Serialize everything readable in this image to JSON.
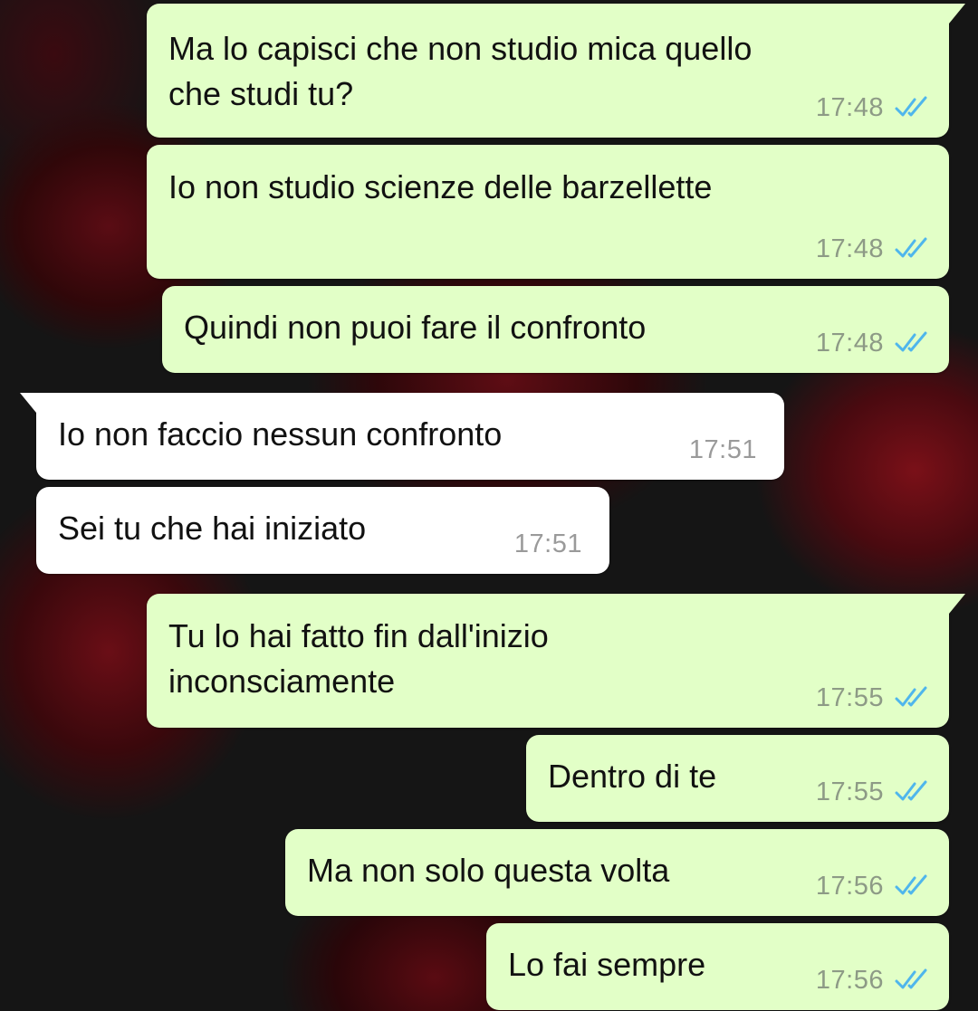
{
  "chat": {
    "accent_tick_color": "#4fb6ec",
    "outgoing_bubble_color": "#e2ffc7",
    "incoming_bubble_color": "#ffffff",
    "messages": [
      {
        "direction": "outgoing",
        "text": "Ma lo capisci che non studio mica quello\nche studi tu?",
        "time": "17:48",
        "status": "read-double-tick-icon"
      },
      {
        "direction": "outgoing",
        "text": "Io non studio scienze delle barzellette",
        "time": "17:48",
        "status": "read-double-tick-icon"
      },
      {
        "direction": "outgoing",
        "text": "Quindi non puoi fare il confronto",
        "time": "17:48",
        "status": "read-double-tick-icon"
      },
      {
        "direction": "incoming",
        "text": "Io non faccio nessun confronto",
        "time": "17:51"
      },
      {
        "direction": "incoming",
        "text": "Sei tu che hai iniziato",
        "time": "17:51"
      },
      {
        "direction": "outgoing",
        "text": "Tu lo hai fatto fin dall'inizio\ninconsciamente",
        "time": "17:55",
        "status": "read-double-tick-icon"
      },
      {
        "direction": "outgoing",
        "text": "Dentro di te",
        "time": "17:55",
        "status": "read-double-tick-icon"
      },
      {
        "direction": "outgoing",
        "text": "Ma non solo questa volta",
        "time": "17:56",
        "status": "read-double-tick-icon"
      },
      {
        "direction": "outgoing",
        "text": "Lo fai sempre",
        "time": "17:56",
        "status": "read-double-tick-icon"
      }
    ]
  }
}
